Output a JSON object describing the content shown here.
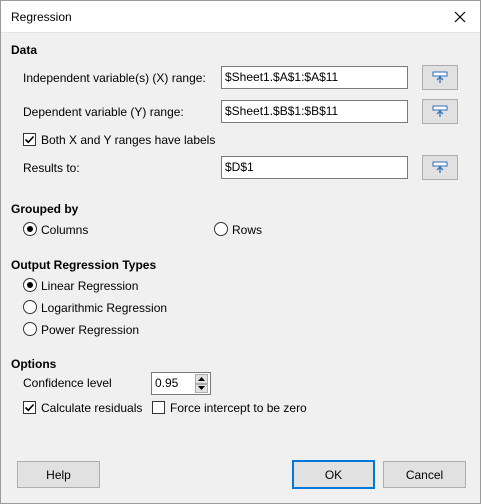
{
  "window": {
    "title": "Regression"
  },
  "data_section": {
    "heading": "Data",
    "x_range": {
      "label": "Independent variable(s) (X) range:",
      "value": "$Sheet1.$A$1:$A$11"
    },
    "y_range": {
      "label": "Dependent variable (Y) range:",
      "value": "$Sheet1.$B$1:$B$11"
    },
    "labels_checkbox": {
      "label": "Both X and Y ranges have labels",
      "checked": true
    },
    "results_to": {
      "label": "Results to:",
      "value": "$D$1"
    }
  },
  "grouped_by": {
    "heading": "Grouped by",
    "columns_label": "Columns",
    "rows_label": "Rows",
    "selected": "Columns"
  },
  "output_types": {
    "heading": "Output Regression Types",
    "linear_label": "Linear Regression",
    "log_label": "Logarithmic Regression",
    "power_label": "Power Regression",
    "selected": "Linear Regression"
  },
  "options": {
    "heading": "Options",
    "confidence_label": "Confidence level",
    "confidence_value": "0.95",
    "residuals_label": "Calculate residuals",
    "residuals_checked": true,
    "intercept_label": "Force intercept to be zero",
    "intercept_checked": false
  },
  "buttons": {
    "help": "Help",
    "ok": "OK",
    "cancel": "Cancel"
  },
  "icons": {
    "close": "close-icon",
    "shrink": "shrink-range-icon",
    "check": "checkmark-icon",
    "spin_up": "arrow-up-icon",
    "spin_down": "arrow-down-icon"
  },
  "colors": {
    "accent": "#0078d7",
    "shrink_icon": "#2a6cb8"
  }
}
